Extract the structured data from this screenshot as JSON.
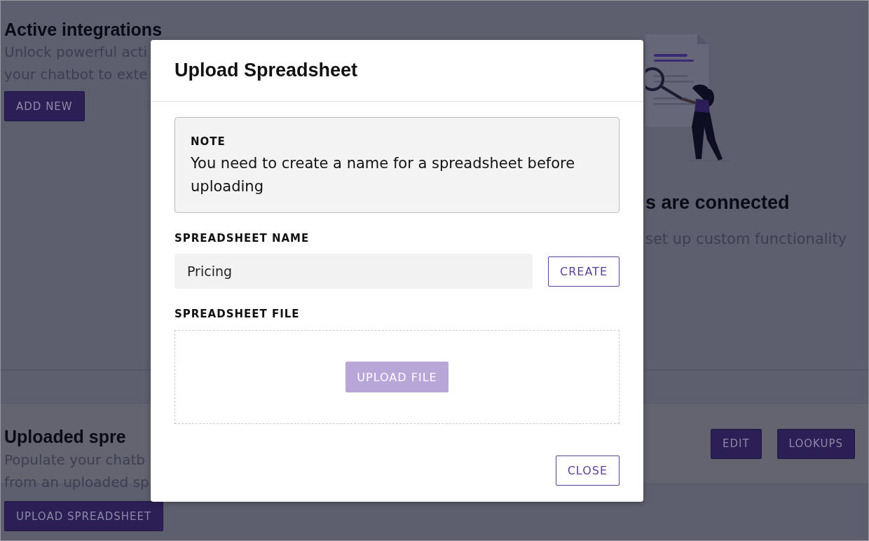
{
  "background": {
    "integrations": {
      "title": "Active integrations",
      "description": [
        "Unlock powerful acti",
        "your chatbot to exte"
      ],
      "button": "ADD NEW"
    },
    "empty_state": {
      "title": "s are connected",
      "description": "set up custom functionality"
    },
    "spreadsheets": {
      "title": "Uploaded spre",
      "description": [
        "Populate your chatb",
        "from an uploaded sp"
      ],
      "actions": [
        "EDIT",
        "LOOKUPS"
      ],
      "button": "UPLOAD SPREADSHEET"
    }
  },
  "modal": {
    "title": "Upload Spreadsheet",
    "note": {
      "label": "NOTE",
      "text": "You need to create a name for a spreadsheet before uploading"
    },
    "name_field": {
      "label": "SPREADSHEET NAME",
      "value": "Pricing",
      "button": "CREATE"
    },
    "file_field": {
      "label": "SPREADSHEET FILE",
      "button": {
        "label": "UPLOAD FILE",
        "disabled": true
      }
    },
    "close": "CLOSE"
  }
}
